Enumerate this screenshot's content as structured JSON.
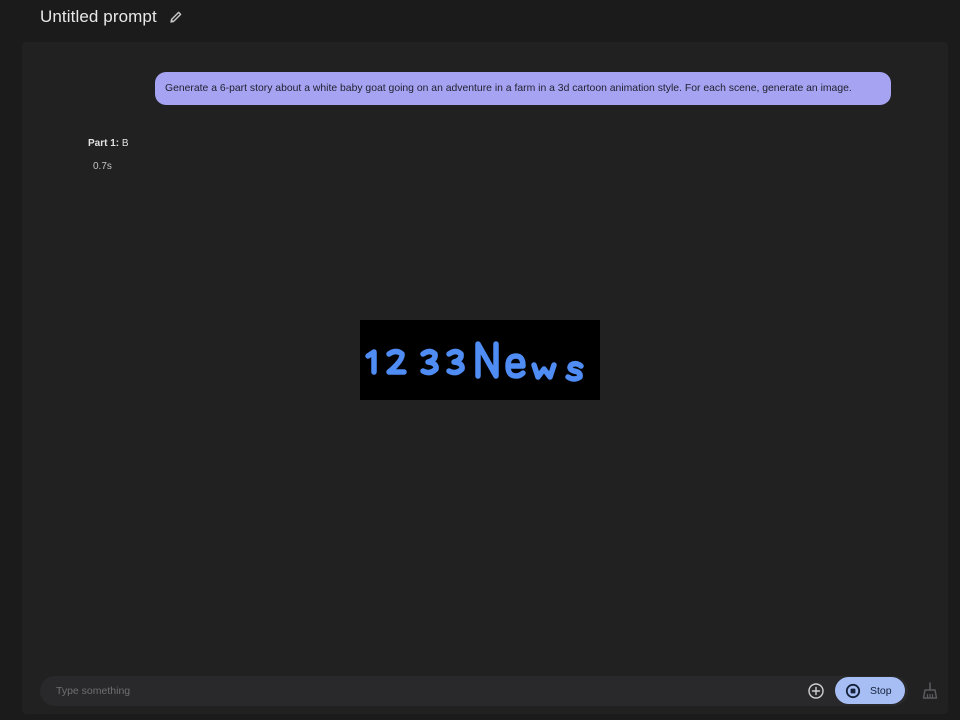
{
  "header": {
    "title": "Untitled prompt",
    "edit_icon": "pencil-icon"
  },
  "chat": {
    "user_message": "Generate a 6-part story about a white baby goat going on an adventure in a farm in a 3d cartoon animation style. For each scene, generate an image.",
    "response": {
      "bold_prefix": "Part 1:",
      "text": " B"
    },
    "timing": "0.7s"
  },
  "watermark": {
    "text": "1233News",
    "color": "#4f8df5"
  },
  "input": {
    "placeholder": "Type something",
    "value": ""
  },
  "actions": {
    "add_icon": "plus-circle-icon",
    "stop_label": "Stop",
    "stop_icon": "stop-circle-icon",
    "clear_icon": "broom-icon"
  },
  "colors": {
    "background": "#1b1b1c",
    "panel": "#212122",
    "user_bubble": "#a6a4f2",
    "stop_button": "#a6bef4"
  }
}
